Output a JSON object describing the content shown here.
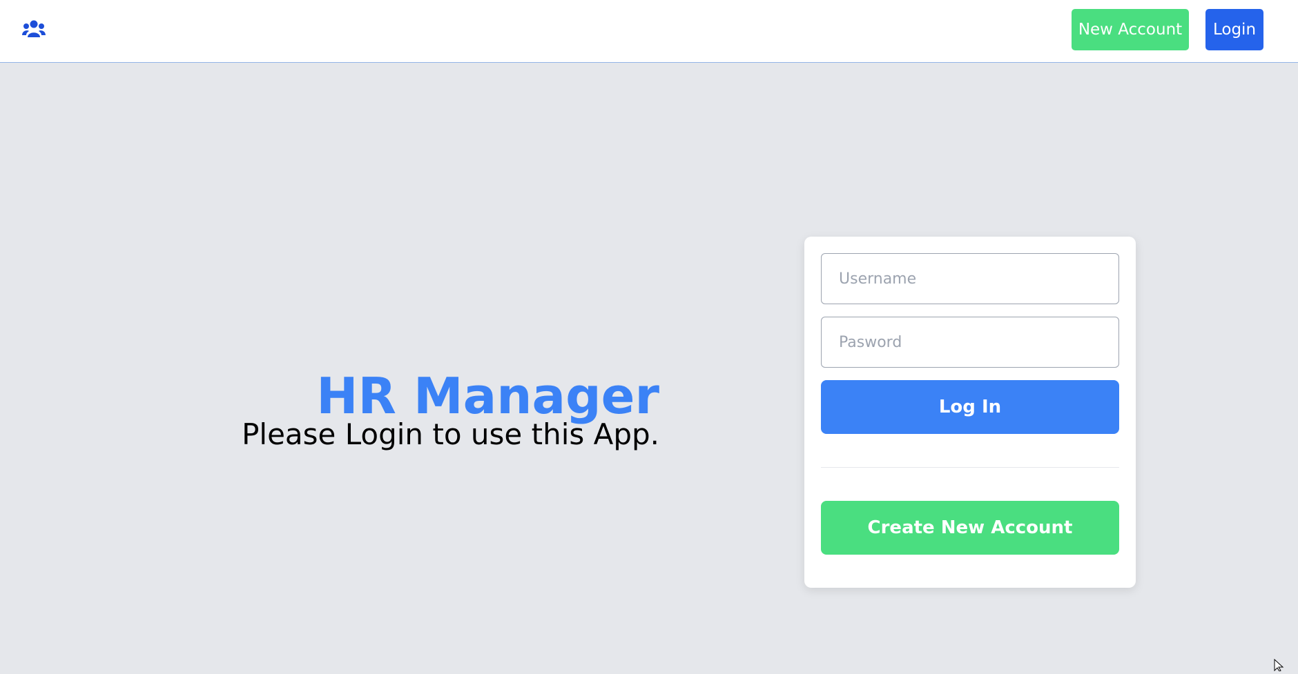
{
  "navbar": {
    "logo_icon": "users-icon",
    "new_account_label": "New Account",
    "login_label": "Login"
  },
  "hero": {
    "title": "HR Manager",
    "subtitle": "Please Login to use this App."
  },
  "login_form": {
    "username_placeholder": "Username",
    "username_value": "",
    "password_placeholder": "Pasword",
    "password_value": "",
    "login_button_label": "Log In",
    "create_account_button_label": "Create New Account"
  },
  "colors": {
    "brand_blue": "#3b82f6",
    "nav_login_blue": "#2563eb",
    "brand_green": "#4ade80",
    "page_background": "#e5e7eb"
  }
}
